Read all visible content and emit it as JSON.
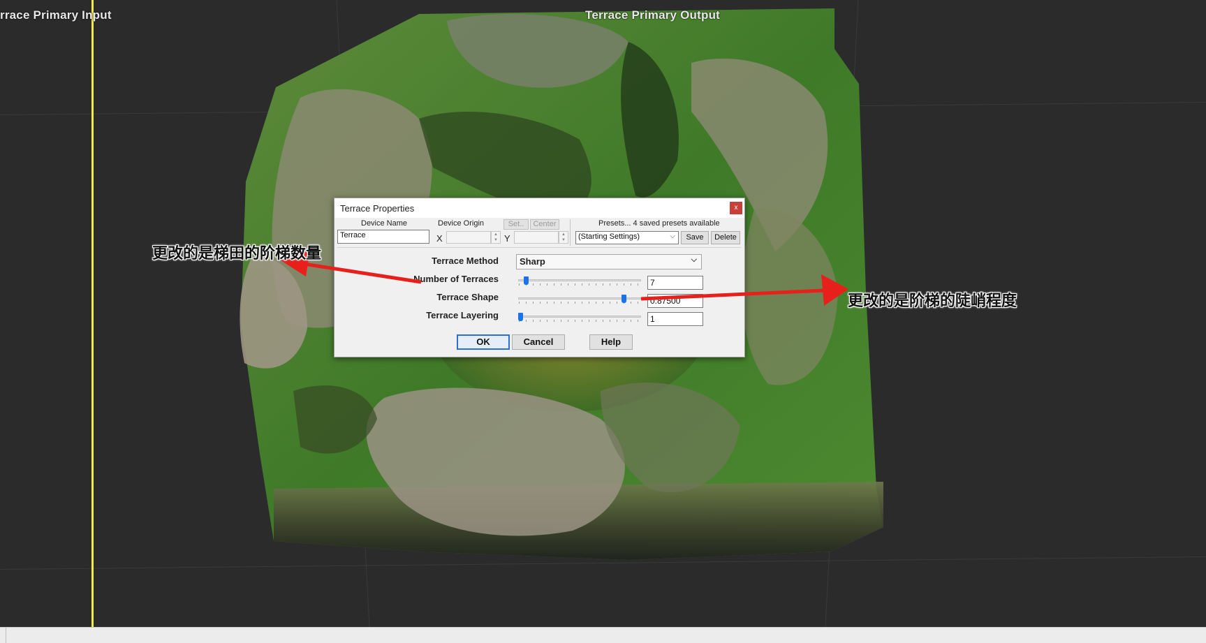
{
  "viewport": {
    "left_label": "rrace Primary Input",
    "right_label": "Terrace Primary Output"
  },
  "dialog": {
    "title": "Terrace Properties",
    "close_glyph": "x",
    "device_name_label": "Device Name",
    "device_name_value": "Terrace",
    "device_origin_label": "Device Origin",
    "set_label": "Set..",
    "center_label": "Center",
    "x_label": "X",
    "y_label": "Y",
    "presets_label": "Presets... 4 saved presets available",
    "preset_selected": "(Starting Settings)",
    "save_label": "Save",
    "delete_label": "Delete",
    "method_label": "Terrace Method",
    "method_value": "Sharp",
    "terraces_label": "Number of Terraces",
    "terraces_value": "7",
    "terraces_fraction": 0.05,
    "shape_label": "Terrace Shape",
    "shape_value": "0.87500",
    "shape_fraction": 0.875,
    "layering_label": "Terrace Layering",
    "layering_value": "1",
    "layering_fraction": 0.0,
    "ok_label": "OK",
    "cancel_label": "Cancel",
    "help_label": "Help"
  },
  "annotations": {
    "left": "更改的是梯田的阶梯数量",
    "right": "更改的是阶梯的陡峭程度",
    "arrow_color": "#e8201c"
  }
}
